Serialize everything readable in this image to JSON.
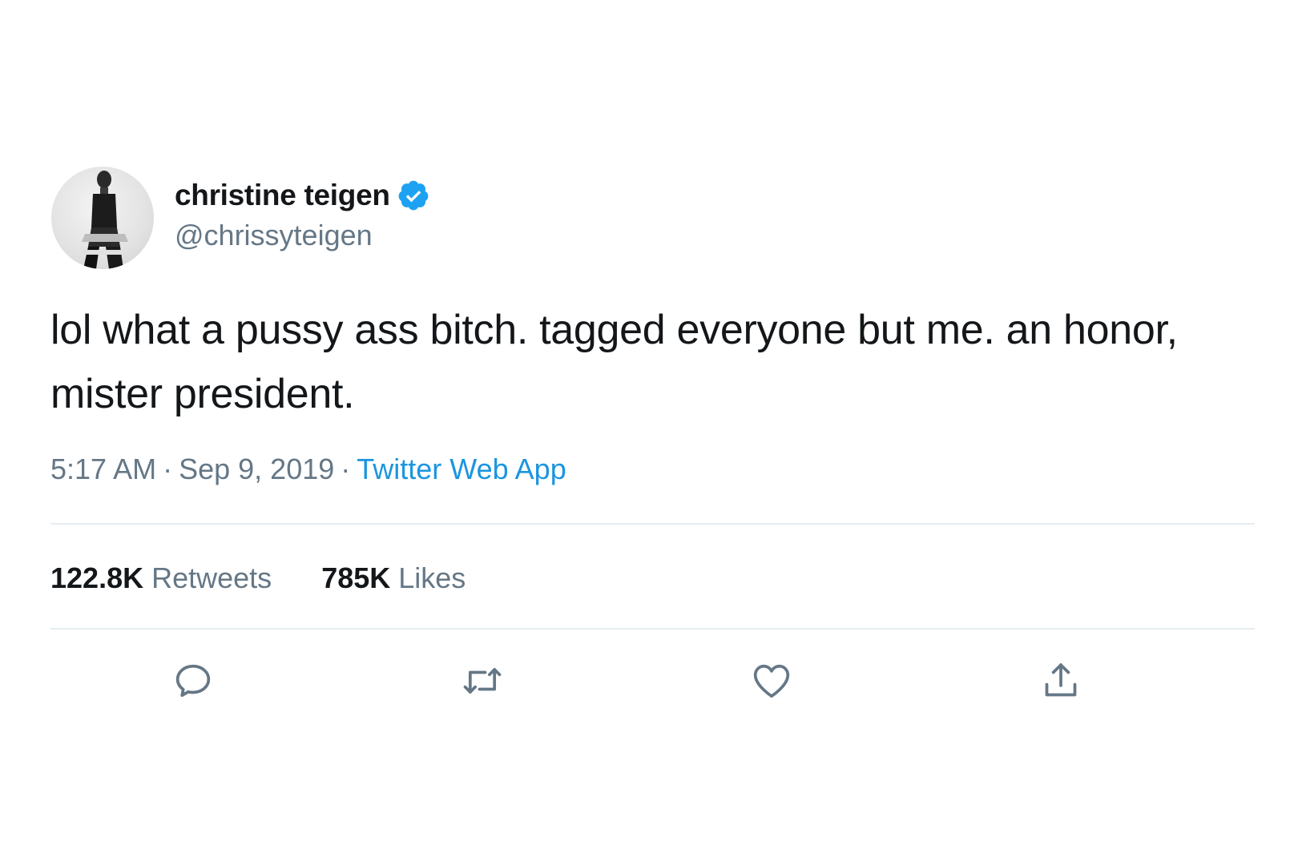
{
  "tweet": {
    "display_name": "christine teigen",
    "handle": "@chrissyteigen",
    "verified": true,
    "text": "lol what a pussy ass bitch. tagged everyone but me. an honor, mister president.",
    "time": "5:17 AM",
    "separator": "·",
    "date": "Sep 9, 2019",
    "source": "Twitter Web App",
    "stats": {
      "retweets_count": "122.8K",
      "retweets_label": "Retweets",
      "likes_count": "785K",
      "likes_label": "Likes"
    },
    "actions": [
      "reply-icon",
      "retweet-icon",
      "like-icon",
      "share-icon"
    ]
  },
  "colors": {
    "text": "#14171a",
    "secondary": "#657786",
    "link": "#1b95e0",
    "verified": "#1da1f2",
    "divider": "#e6ecf0"
  }
}
